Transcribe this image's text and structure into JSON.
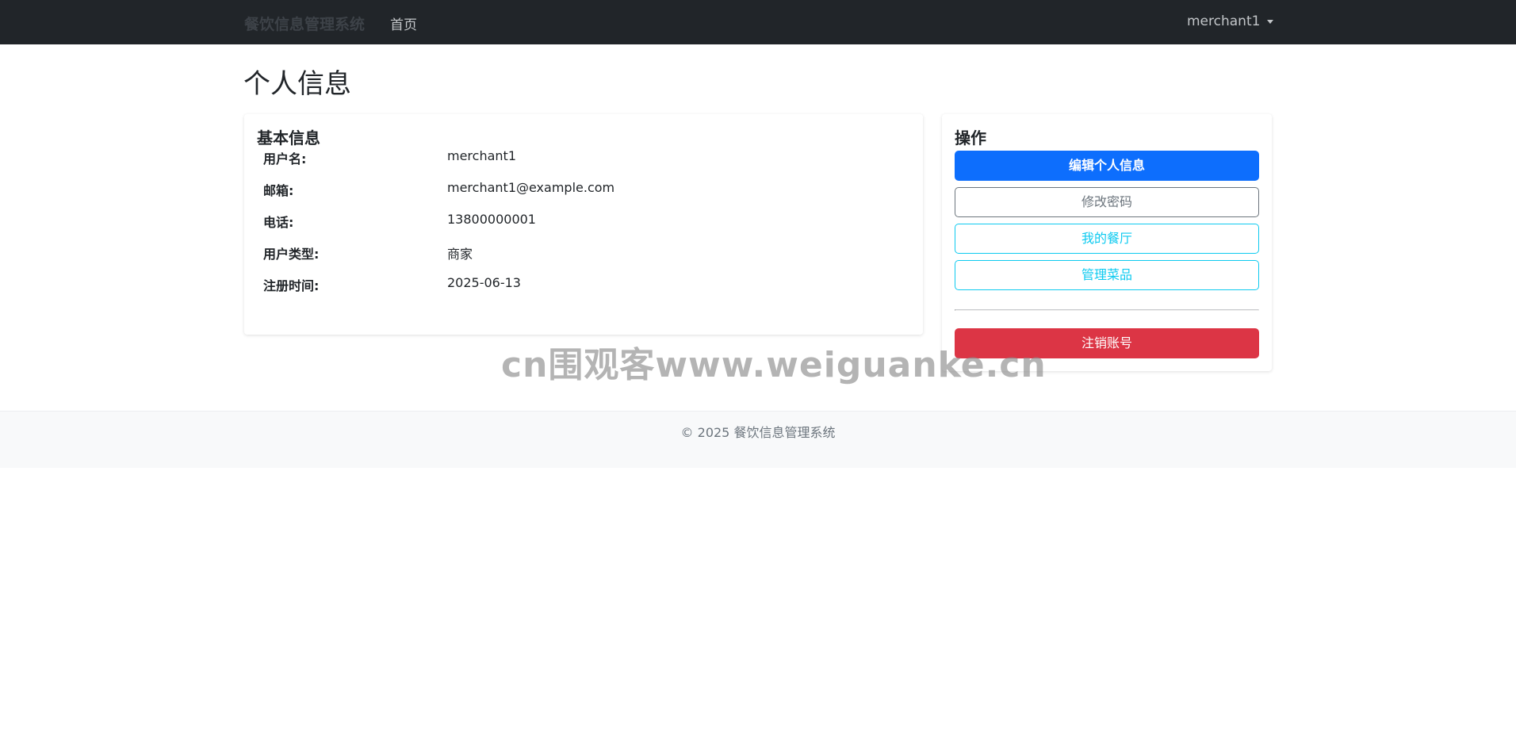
{
  "navbar": {
    "brand": "餐饮信息管理系统",
    "home": "首页",
    "user": "merchant1"
  },
  "page": {
    "title": "个人信息"
  },
  "basic_info": {
    "title": "基本信息",
    "rows": [
      {
        "label": "用户名:",
        "value": "merchant1"
      },
      {
        "label": "邮箱:",
        "value": "merchant1@example.com"
      },
      {
        "label": "电话:",
        "value": "13800000001"
      },
      {
        "label": "用户类型:",
        "value": "商家"
      },
      {
        "label": "注册时间:",
        "value": "2025-06-13"
      }
    ]
  },
  "actions": {
    "title": "操作",
    "edit_profile": "编辑个人信息",
    "change_password": "修改密码",
    "my_restaurant": "我的餐厅",
    "manage_dishes": "管理菜品",
    "delete_account": "注销账号"
  },
  "watermark": "cn围观客www.weiguanke.cn",
  "footer": {
    "text": "© 2025 餐饮信息管理系统"
  },
  "colors": {
    "navbar": "#212529",
    "primary": "#0d6efd",
    "secondary": "#6c757d",
    "info": "#0dcaf0",
    "danger": "#dc3545",
    "footer_bg": "#f8f9fa"
  }
}
